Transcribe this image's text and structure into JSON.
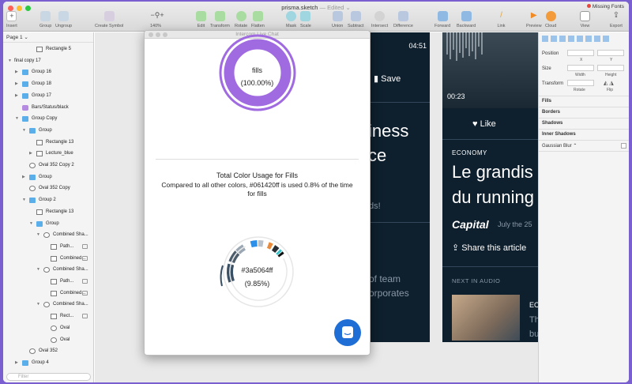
{
  "window": {
    "title": "prisma.sketch",
    "status": "— Edited ⌄",
    "missing_fonts": "Missing Fonts"
  },
  "toolbar": {
    "insert": "Insert",
    "group": "Group",
    "ungroup": "Ungroup",
    "create_symbol": "Create Symbol",
    "zoom": "140%",
    "edit": "Edit",
    "transform": "Transform",
    "rotate": "Rotate",
    "flatten": "Flatten",
    "mask": "Mask",
    "scale": "Scale",
    "union": "Union",
    "subtract": "Subtract",
    "intersect": "Intersect",
    "difference": "Difference",
    "forward": "Forward",
    "backward": "Backward",
    "link": "Link",
    "preview": "Preview",
    "cloud": "Cloud",
    "view": "View",
    "export": "Export"
  },
  "sidebar": {
    "page": "Page 1 ⌄",
    "filter_placeholder": "Filter",
    "layers": [
      {
        "label": "Rectangle 5",
        "icon": "rect"
      },
      {
        "label": "final copy 17",
        "icon": "none"
      },
      {
        "label": "Group 16",
        "icon": "folder"
      },
      {
        "label": "Group 18",
        "icon": "folder"
      },
      {
        "label": "Group 17",
        "icon": "folder"
      },
      {
        "label": "Bars/Status/black",
        "icon": "symbol"
      },
      {
        "label": "Group Copy",
        "icon": "folder"
      },
      {
        "label": "Group",
        "icon": "folder"
      },
      {
        "label": "Rectangle 13",
        "icon": "rect"
      },
      {
        "label": "Lecture_blue",
        "icon": "image"
      },
      {
        "label": "Oval 352 Copy 2",
        "icon": "oval"
      },
      {
        "label": "Group",
        "icon": "folder"
      },
      {
        "label": "Oval 352 Copy",
        "icon": "oval"
      },
      {
        "label": "Group 2",
        "icon": "folder"
      },
      {
        "label": "Rectangle 13",
        "icon": "rect"
      },
      {
        "label": "Group",
        "icon": "folder"
      },
      {
        "label": "Combined Sha...",
        "icon": "combined"
      },
      {
        "label": "Path...",
        "icon": "path"
      },
      {
        "label": "Combined...",
        "icon": "path"
      },
      {
        "label": "Combined Sha...",
        "icon": "combined"
      },
      {
        "label": "Path...",
        "icon": "path"
      },
      {
        "label": "Combined...",
        "icon": "path"
      },
      {
        "label": "Combined Sha...",
        "icon": "combined"
      },
      {
        "label": "Rect...",
        "icon": "rect"
      },
      {
        "label": "Oval",
        "icon": "oval"
      },
      {
        "label": "Oval",
        "icon": "oval"
      },
      {
        "label": "Oval 352",
        "icon": "oval"
      },
      {
        "label": "Group 4",
        "icon": "folder"
      }
    ]
  },
  "chat": {
    "title": "Intercom Live Chat",
    "top_ring_label": "fills",
    "top_ring_pct": "(100.00%)",
    "heading": "Total Color Usage for Fills",
    "desc1": "Compared to all other colors, #061420ff is used 0.8% of the time",
    "desc2": "for fills",
    "ring_color": "#3a5064ff",
    "ring_pct": "(9.85%)"
  },
  "artboard": {
    "time1": "04:51",
    "save": "Save",
    "snip1a": "iness",
    "snip1b": "ce",
    "snip1c": "ds!",
    "snip1d": "of team",
    "snip1e": "orporates",
    "time2": "00:23",
    "like": "Like",
    "economy": "ECONOMY",
    "headline1": "Le grandis",
    "headline2": "du running",
    "capital": "Capital",
    "date": "July the 25",
    "share": "Share this article",
    "next_audio": "NEXT IN AUDIO",
    "ec": "EC",
    "th": "Th",
    "bu": "bu"
  },
  "inspector": {
    "position": "Position",
    "x": "X",
    "y": "Y",
    "size": "Size",
    "width": "Width",
    "height": "Height",
    "transform": "Transform",
    "rotate": "Rotate",
    "flip": "Flip",
    "fills": "Fills",
    "borders": "Borders",
    "shadows": "Shadows",
    "inner_shadows": "Inner Shadows",
    "gaussian": "Gaussian Blur ⌃"
  },
  "colors": {
    "accent": "#a06be0",
    "ring_dark": "#3a5064",
    "intercom": "#1f6ed6",
    "artboard": "#0e1f2d"
  }
}
